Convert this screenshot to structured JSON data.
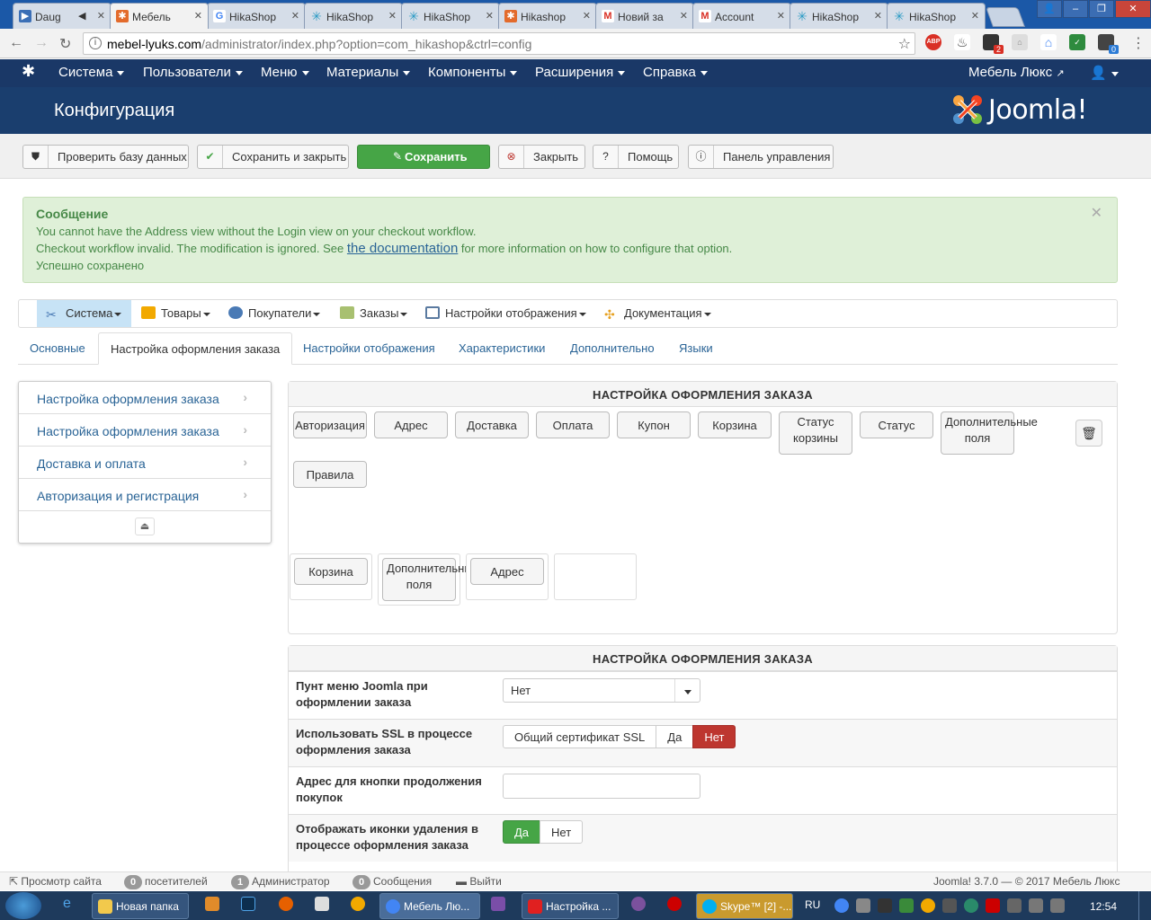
{
  "browser": {
    "tabs": [
      {
        "label": "Daug",
        "color": "#3b6fb6",
        "icon": "play-icon"
      },
      {
        "label": "Мебель",
        "color": "#e36b2c",
        "icon": "joomla-icon"
      },
      {
        "label": "HikaShop",
        "color": "#4285f4",
        "icon": "google-icon"
      },
      {
        "label": "HikaShop",
        "color": "#2b9bc4",
        "icon": "hikashop-icon"
      },
      {
        "label": "HikaShop",
        "color": "#2b9bc4",
        "icon": "hikashop-icon"
      },
      {
        "label": "Hikashop",
        "color": "#e36b2c",
        "icon": "joomla-icon"
      },
      {
        "label": "Новий за",
        "color": "#d93025",
        "icon": "gmail-icon"
      },
      {
        "label": "Account",
        "color": "#d93025",
        "icon": "gmail-icon"
      },
      {
        "label": "HikaShop",
        "color": "#2b9bc4",
        "icon": "hikashop-icon"
      },
      {
        "label": "HikaShop",
        "color": "#2b9bc4",
        "icon": "hikashop-icon"
      }
    ],
    "url_host": "mebel-lyuks.com",
    "url_path": "/administrator/index.php?option=com_hikashop&ctrl=config",
    "ext_abp": "ABP",
    "ext_badge_1": "2",
    "ext_badge_2": "0"
  },
  "joomla": {
    "nav": [
      "Система",
      "Пользователи",
      "Меню",
      "Материалы",
      "Компоненты",
      "Расширения",
      "Справка"
    ],
    "site_link": "Мебель Люкс",
    "page_title": "Конфигурация",
    "logo_text": "Joomla!",
    "toolbar": {
      "check_db": "Проверить базу данных",
      "save_close": "Сохранить и закрыть",
      "save": "Сохранить",
      "close": "Закрыть",
      "help": "Помощь",
      "cpanel": "Панель управления"
    }
  },
  "message": {
    "heading": "Сообщение",
    "line1": "You cannot have the Address view without the Login view on your checkout workflow.",
    "line2_pre": "Checkout workflow invalid. The modification is ignored. See ",
    "line2_link": "the documentation",
    "line2_post": " for more information on how to configure that option.",
    "line3": "Успешно сохранено"
  },
  "hikamenu": [
    {
      "label": "Система",
      "icon": "tools-icon",
      "color": "#4a7ab5"
    },
    {
      "label": "Товары",
      "icon": "box-icon",
      "color": "#f2a900"
    },
    {
      "label": "Покупатели",
      "icon": "users-icon",
      "color": "#4a7ab5"
    },
    {
      "label": "Заказы",
      "icon": "orders-icon",
      "color": "#7a9a4a"
    },
    {
      "label": "Настройки отображения",
      "icon": "display-icon",
      "color": "#5a7aa0"
    },
    {
      "label": "Документация",
      "icon": "docs-icon",
      "color": "#e6a020"
    }
  ],
  "tabs": [
    "Основные",
    "Настройка оформления заказа",
    "Настройки отображения",
    "Характеристики",
    "Дополнительно",
    "Языки"
  ],
  "side": {
    "items": [
      "Настройка оформления заказа",
      "Настройка оформления заказа",
      "Доставка и оплата",
      "Авторизация и регистрация"
    ]
  },
  "workflow": {
    "title": "НАСТРОЙКА ОФОРМЛЕНИЯ ЗАКАЗА",
    "available": {
      "login": "Авторизация",
      "address": "Адрес",
      "shipping": "Доставка",
      "payment": "Оплата",
      "coupon": "Купон",
      "cart": "Корзина",
      "cart_status_1": "Статус",
      "cart_status_2": "корзины",
      "status": "Статус",
      "fields_1": "Дополнительные",
      "fields_2": "поля",
      "terms": "Правила"
    },
    "step": {
      "cart": "Корзина",
      "fields_1": "Дополнительные",
      "fields_2": "поля",
      "address": "Адрес"
    }
  },
  "settings": {
    "title": "НАСТРОЙКА ОФОРМЛЕНИЯ ЗАКАЗА",
    "menu_label": "Пунт меню Joomla при оформлении заказа",
    "menu_value": "Нет",
    "ssl_label": "Использовать SSL в процессе оформления заказа",
    "ssl_opts": [
      "Общий сертификат SSL",
      "Да",
      "Нет"
    ],
    "continue_label": "Адрес для кнопки продолжения покупок",
    "delete_label": "Отображать иконки удаления в процессе оформления заказа",
    "delete_opts": [
      "Да",
      "Нет"
    ]
  },
  "status": {
    "view_site": "Просмотр сайта",
    "visitors_count": "0",
    "visitors": "посетителей",
    "admins_count": "1",
    "admins": "Администратор",
    "messages_count": "0",
    "messages": "Сообщения",
    "logout": "Выйти",
    "copyright": "Joomla! 3.7.0 — © 2017 Мебель Люкс"
  },
  "taskbar": {
    "folder": "Новая папка",
    "chrome": "Мебель Лю...",
    "yandex": "Настройка ...",
    "skype": "Skype™ [2] -...",
    "lang": "RU",
    "time": "12:54"
  }
}
